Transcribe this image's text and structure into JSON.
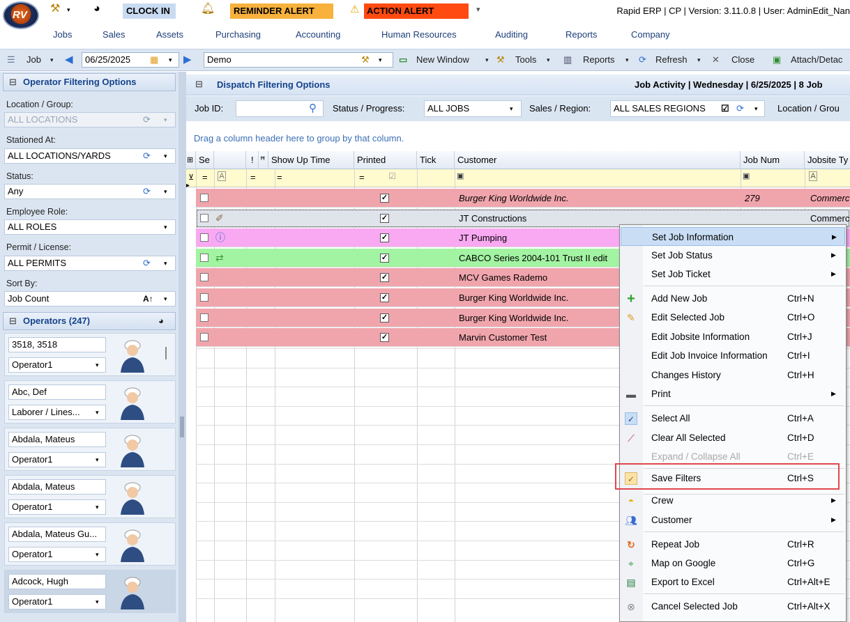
{
  "titlebar": {
    "clock_in": "CLOCK IN",
    "reminder": "REMINDER ALERT",
    "action": "ACTION ALERT",
    "app_title": "Rapid ERP | CP | Version: 3.11.0.8 | User: AdminEdit_Nan"
  },
  "menubar": {
    "items": [
      "Jobs",
      "Sales",
      "Assets",
      "Purchasing",
      "Accounting",
      "Human Resources",
      "Auditing",
      "Reports",
      "Company"
    ]
  },
  "toolbar": {
    "job": "Job",
    "date": "06/25/2025",
    "search_value": "Demo",
    "new_window": "New Window",
    "tools": "Tools",
    "reports": "Reports",
    "refresh": "Refresh",
    "close": "Close",
    "attach": "Attach/Detac"
  },
  "left": {
    "operator_filter_title": "Operator Filtering Options",
    "location_label": "Location / Group:",
    "location_value": "ALL LOCATIONS",
    "stationed_label": "Stationed At:",
    "stationed_value": "ALL LOCATIONS/YARDS",
    "status_label": "Status:",
    "status_value": "Any",
    "role_label": "Employee Role:",
    "role_value": "ALL ROLES",
    "permit_label": "Permit / License:",
    "permit_value": "ALL PERMITS",
    "sort_label": "Sort By:",
    "sort_value": "Job Count",
    "operators_title": "Operators (247)",
    "operators": [
      {
        "name": "3518, 3518",
        "role": "Operator1"
      },
      {
        "name": "Abc, Def",
        "role": "Laborer / Lines..."
      },
      {
        "name": "Abdala, Mateus",
        "role": "Operator1"
      },
      {
        "name": "Abdala, Mateus",
        "role": "Operator1"
      },
      {
        "name": "Abdala, Mateus Gu...",
        "role": "Operator1"
      },
      {
        "name": "Adcock, Hugh",
        "role": "Operator1"
      }
    ]
  },
  "main": {
    "dispatch_title": "Dispatch Filtering Options",
    "activity_title": "Job Activity | Wednesday | 6/25/2025 | 8 Job",
    "job_id_label": "Job ID:",
    "status_label": "Status / Progress:",
    "status_value": "ALL JOBS",
    "sales_label": "Sales / Region:",
    "sales_value": "ALL SALES REGIONS",
    "location_label": "Location / Grou",
    "group_hint": "Drag a column header here to group by that column.",
    "columns": [
      "Se",
      "!",
      "Show Up Time",
      "Printed",
      "Tick",
      "Customer",
      "Job Num",
      "Jobsite Ty"
    ],
    "rows": [
      {
        "customer": "Burger King Worldwide Inc.",
        "job_num": "279",
        "jobsite": "Commerc",
        "color": "#f0a5ad",
        "italic": true
      },
      {
        "customer": "JT Constructions",
        "job_num": "",
        "jobsite": "Commerc",
        "color": "#dfe3ea",
        "italic": false
      },
      {
        "customer": "JT Pumping",
        "job_num": "",
        "jobsite": "",
        "color": "#f9a8f2",
        "italic": false
      },
      {
        "customer": "CABCO Series 2004-101 Trust II edit",
        "job_num": "",
        "jobsite": "",
        "color": "#a2f3a2",
        "italic": false
      },
      {
        "customer": "MCV Games Rademo",
        "job_num": "",
        "jobsite": "",
        "color": "#f0a5ad",
        "italic": false
      },
      {
        "customer": "Burger King Worldwide Inc.",
        "job_num": "",
        "jobsite": "",
        "color": "#f0a5ad",
        "italic": false
      },
      {
        "customer": "Burger King Worldwide Inc.",
        "job_num": "",
        "jobsite": "",
        "color": "#f0a5ad",
        "italic": false
      },
      {
        "customer": "Marvin Customer Test",
        "job_num": "",
        "jobsite": "",
        "color": "#f0a5ad",
        "italic": false
      }
    ]
  },
  "context_menu": {
    "set_job_information": "Set Job Information",
    "set_job_status": "Set Job Status",
    "set_job_ticket": "Set Job Ticket",
    "add_new_job": "Add New Job",
    "add_new_job_sc": "Ctrl+N",
    "edit_selected_job": "Edit Selected Job",
    "edit_selected_job_sc": "Ctrl+O",
    "edit_jobsite": "Edit Jobsite Information",
    "edit_jobsite_sc": "Ctrl+J",
    "edit_invoice": "Edit Job Invoice Information",
    "edit_invoice_sc": "Ctrl+I",
    "changes_history": "Changes History",
    "changes_history_sc": "Ctrl+H",
    "print": "Print",
    "select_all": "Select All",
    "select_all_sc": "Ctrl+A",
    "clear_all": "Clear All Selected",
    "clear_all_sc": "Ctrl+D",
    "expand_collapse": "Expand / Collapse All",
    "expand_collapse_sc": "Ctrl+E",
    "save_filters": "Save Filters",
    "save_filters_sc": "Ctrl+S",
    "crew": "Crew",
    "customer": "Customer",
    "repeat_job": "Repeat Job",
    "repeat_job_sc": "Ctrl+R",
    "map_google": "Map on Google",
    "map_google_sc": "Ctrl+G",
    "export_excel": "Export to Excel",
    "export_excel_sc": "Ctrl+Alt+E",
    "cancel_job": "Cancel Selected Job",
    "cancel_job_sc": "Ctrl+Alt+X"
  },
  "colors": {
    "highlight_box": "#e0474c",
    "menu_hover": "#c5dcf5",
    "header_text": "#15428b"
  }
}
